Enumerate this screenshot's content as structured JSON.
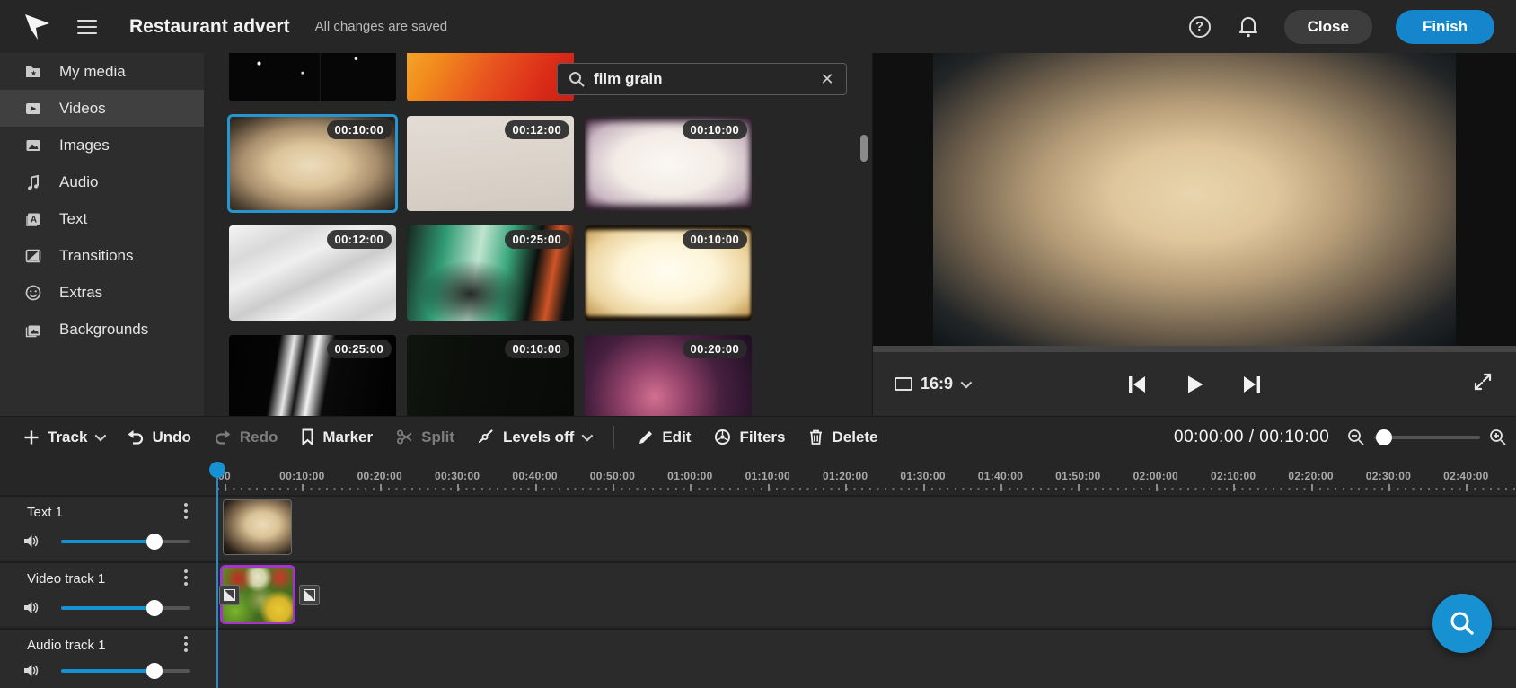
{
  "topbar": {
    "title": "Restaurant advert",
    "status": "All changes are saved",
    "close_label": "Close",
    "finish_label": "Finish",
    "icons": [
      "app-logo",
      "hamburger-menu-icon",
      "help-icon",
      "notifications-bell-icon"
    ]
  },
  "colors": {
    "accent_blue": "#1791d2",
    "finish_button": "#1585cc",
    "selected_clip_border": "#a435c9",
    "selected_thumb_border": "#2596d1"
  },
  "sidebar": {
    "items": [
      {
        "label": "My media",
        "icon": "my-media-folder-icon",
        "selected": false
      },
      {
        "label": "Videos",
        "icon": "videos-icon",
        "selected": true
      },
      {
        "label": "Images",
        "icon": "images-icon",
        "selected": false
      },
      {
        "label": "Audio",
        "icon": "audio-note-icon",
        "selected": false
      },
      {
        "label": "Text",
        "icon": "text-icon",
        "selected": false
      },
      {
        "label": "Transitions",
        "icon": "transitions-icon",
        "selected": false
      },
      {
        "label": "Extras",
        "icon": "extras-smiley-icon",
        "selected": false
      },
      {
        "label": "Backgrounds",
        "icon": "backgrounds-icon",
        "selected": false
      }
    ]
  },
  "media": {
    "search": {
      "value": "film grain",
      "icons": [
        "search-icon",
        "clear-search-icon"
      ]
    },
    "thumbs": [
      {
        "name": "black-specks-video",
        "style": "black-specks",
        "duration": "",
        "row": 0,
        "col": 0,
        "selected": false
      },
      {
        "name": "orange-gradient-video",
        "style": "orange-gradient",
        "duration": "",
        "row": 0,
        "col": 1,
        "selected": false
      },
      {
        "name": "brown-grunge-video",
        "style": "brown-grunge",
        "duration": "",
        "row": 0,
        "col": 2,
        "selected": false
      },
      {
        "name": "warm-vignette-video",
        "style": "warm-vignette",
        "duration": "00:10:00",
        "row": 1,
        "col": 0,
        "selected": true
      },
      {
        "name": "beige-paper-video",
        "style": "beige-paper",
        "duration": "00:12:00",
        "row": 1,
        "col": 1,
        "selected": false
      },
      {
        "name": "white-frame-video",
        "style": "white-frame-purple",
        "duration": "00:10:00",
        "row": 1,
        "col": 2,
        "selected": false
      },
      {
        "name": "crumpled-paper-video",
        "style": "crumpled-paper",
        "duration": "00:12:00",
        "row": 2,
        "col": 0,
        "selected": false
      },
      {
        "name": "teal-grunge-video",
        "style": "teal-grunge",
        "duration": "00:25:00",
        "row": 2,
        "col": 1,
        "selected": false
      },
      {
        "name": "cream-frame-video",
        "style": "cream-frame",
        "duration": "00:10:00",
        "row": 2,
        "col": 2,
        "selected": false
      },
      {
        "name": "black-lightleak-video",
        "style": "black-lightleak",
        "duration": "00:25:00",
        "row": 3,
        "col": 0,
        "selected": false
      },
      {
        "name": "dark-green-video",
        "style": "dark-green",
        "duration": "00:10:00",
        "row": 3,
        "col": 1,
        "selected": false
      },
      {
        "name": "purple-nebula-video",
        "style": "purple-nebula",
        "duration": "00:20:00",
        "row": 3,
        "col": 2,
        "selected": false
      }
    ]
  },
  "preview": {
    "aspect_label": "16:9",
    "controls": [
      "aspect-ratio-button",
      "skip-to-start-button",
      "play-button",
      "skip-to-end-button",
      "fullscreen-button"
    ]
  },
  "timeline": {
    "toolbar": [
      {
        "label": "Track",
        "icon": "plus-icon",
        "chevron": true,
        "disabled": false
      },
      {
        "label": "Undo",
        "icon": "undo-icon",
        "chevron": false,
        "disabled": false
      },
      {
        "label": "Redo",
        "icon": "redo-icon",
        "chevron": false,
        "disabled": true
      },
      {
        "label": "Marker",
        "icon": "marker-icon",
        "chevron": false,
        "disabled": false
      },
      {
        "label": "Split",
        "icon": "split-scissors-icon",
        "chevron": false,
        "disabled": true
      },
      {
        "label": "Levels off",
        "icon": "levels-icon",
        "chevron": true,
        "disabled": false
      },
      {
        "divider": true
      },
      {
        "label": "Edit",
        "icon": "edit-pencil-icon",
        "chevron": false,
        "disabled": false
      },
      {
        "label": "Filters",
        "icon": "filters-icon",
        "chevron": false,
        "disabled": false
      },
      {
        "label": "Delete",
        "icon": "delete-trash-icon",
        "chevron": false,
        "disabled": false
      }
    ],
    "timecode": "00:00:00 / 00:10:00",
    "zoom": {
      "icons": [
        "zoom-out-icon",
        "zoom-in-icon"
      ],
      "slider_value_pct": 2
    },
    "ruler_labels": [
      "00",
      "00:10:00",
      "00:20:00",
      "00:30:00",
      "00:40:00",
      "00:50:00",
      "01:00:00",
      "01:10:00",
      "01:20:00",
      "01:30:00",
      "01:40:00",
      "01:50:00",
      "02:00:00",
      "02:10:00",
      "02:20:00",
      "02:30:00",
      "02:40:00"
    ],
    "tracks": [
      {
        "name": "Text 1",
        "volume_pct": 72
      },
      {
        "name": "Video track 1",
        "volume_pct": 72
      },
      {
        "name": "Audio track 1",
        "volume_pct": 72
      }
    ]
  }
}
